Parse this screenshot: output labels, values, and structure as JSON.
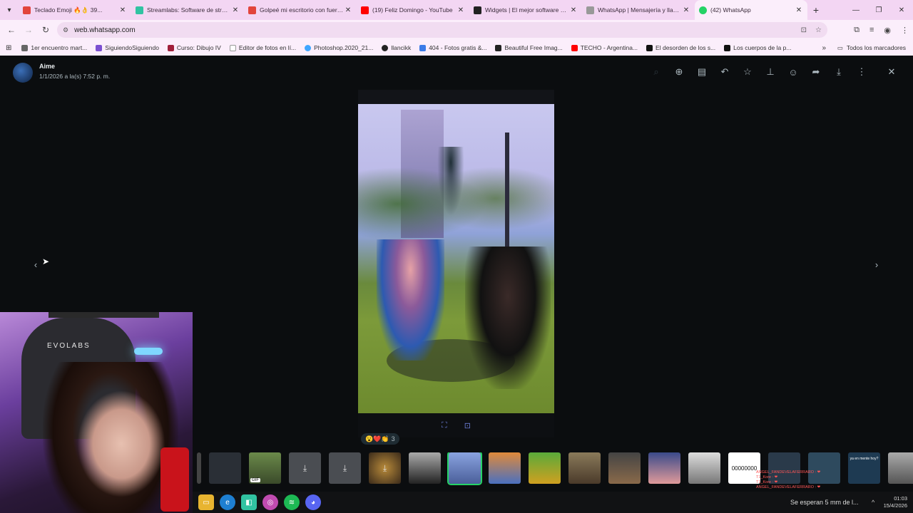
{
  "browser": {
    "tabs": [
      {
        "label": "Teclado Emoji 🔥👌 39...",
        "color": "#e2453c"
      },
      {
        "label": "Streamlabs: Software de stream...",
        "color": "#31c3a2"
      },
      {
        "label": "Golpeé mi escritorio con fuerza...",
        "color": "#e2453c"
      },
      {
        "label": "(19) Feliz Domingo - YouTube",
        "color": "#ff0000"
      },
      {
        "label": "Widgets | El mejor software pa...",
        "color": "#222222"
      },
      {
        "label": "WhatsApp | Mensajería y llama...",
        "color": "#999999"
      },
      {
        "label": "(42) WhatsApp",
        "color": "#25d366"
      }
    ],
    "url": "web.whatsapp.com",
    "bookmarks": [
      "1er encuentro mart...",
      "SiguiendoSiguiendo",
      "Curso: Dibujo IV",
      "Editor de fotos en lí...",
      "Photoshop.2020_21...",
      "llancikk",
      "404 - Fotos gratis &...",
      "Beautiful Free Imag...",
      "TECHO - Argentina...",
      "El desorden de los s...",
      "Los cuerpos de la p..."
    ],
    "all_bookmarks": "Todos los marcadores"
  },
  "viewer": {
    "sender_name": "Aime",
    "sender_time": "1/1/2026 a la(s) 7:52 p. m.",
    "reaction_emojis": "😮❤️👏",
    "reaction_count": "3",
    "strip_text_thumb": "00000000",
    "strip_label_thumb": "ya en mente hoy?"
  },
  "webcam": {
    "brand": "EVOLABS"
  },
  "taskbar": {
    "news": "Se esperan 5 mm de l...",
    "time": "01:03",
    "date": "15/4/2026",
    "chat_lines": [
      "ANGEL_FANDEVELAFERRARO : ❤",
      "T1_Kore : ❤",
      "T1_Kore : ❤",
      "ANGEL_FANDEVELAFERRARO : ❤"
    ]
  }
}
